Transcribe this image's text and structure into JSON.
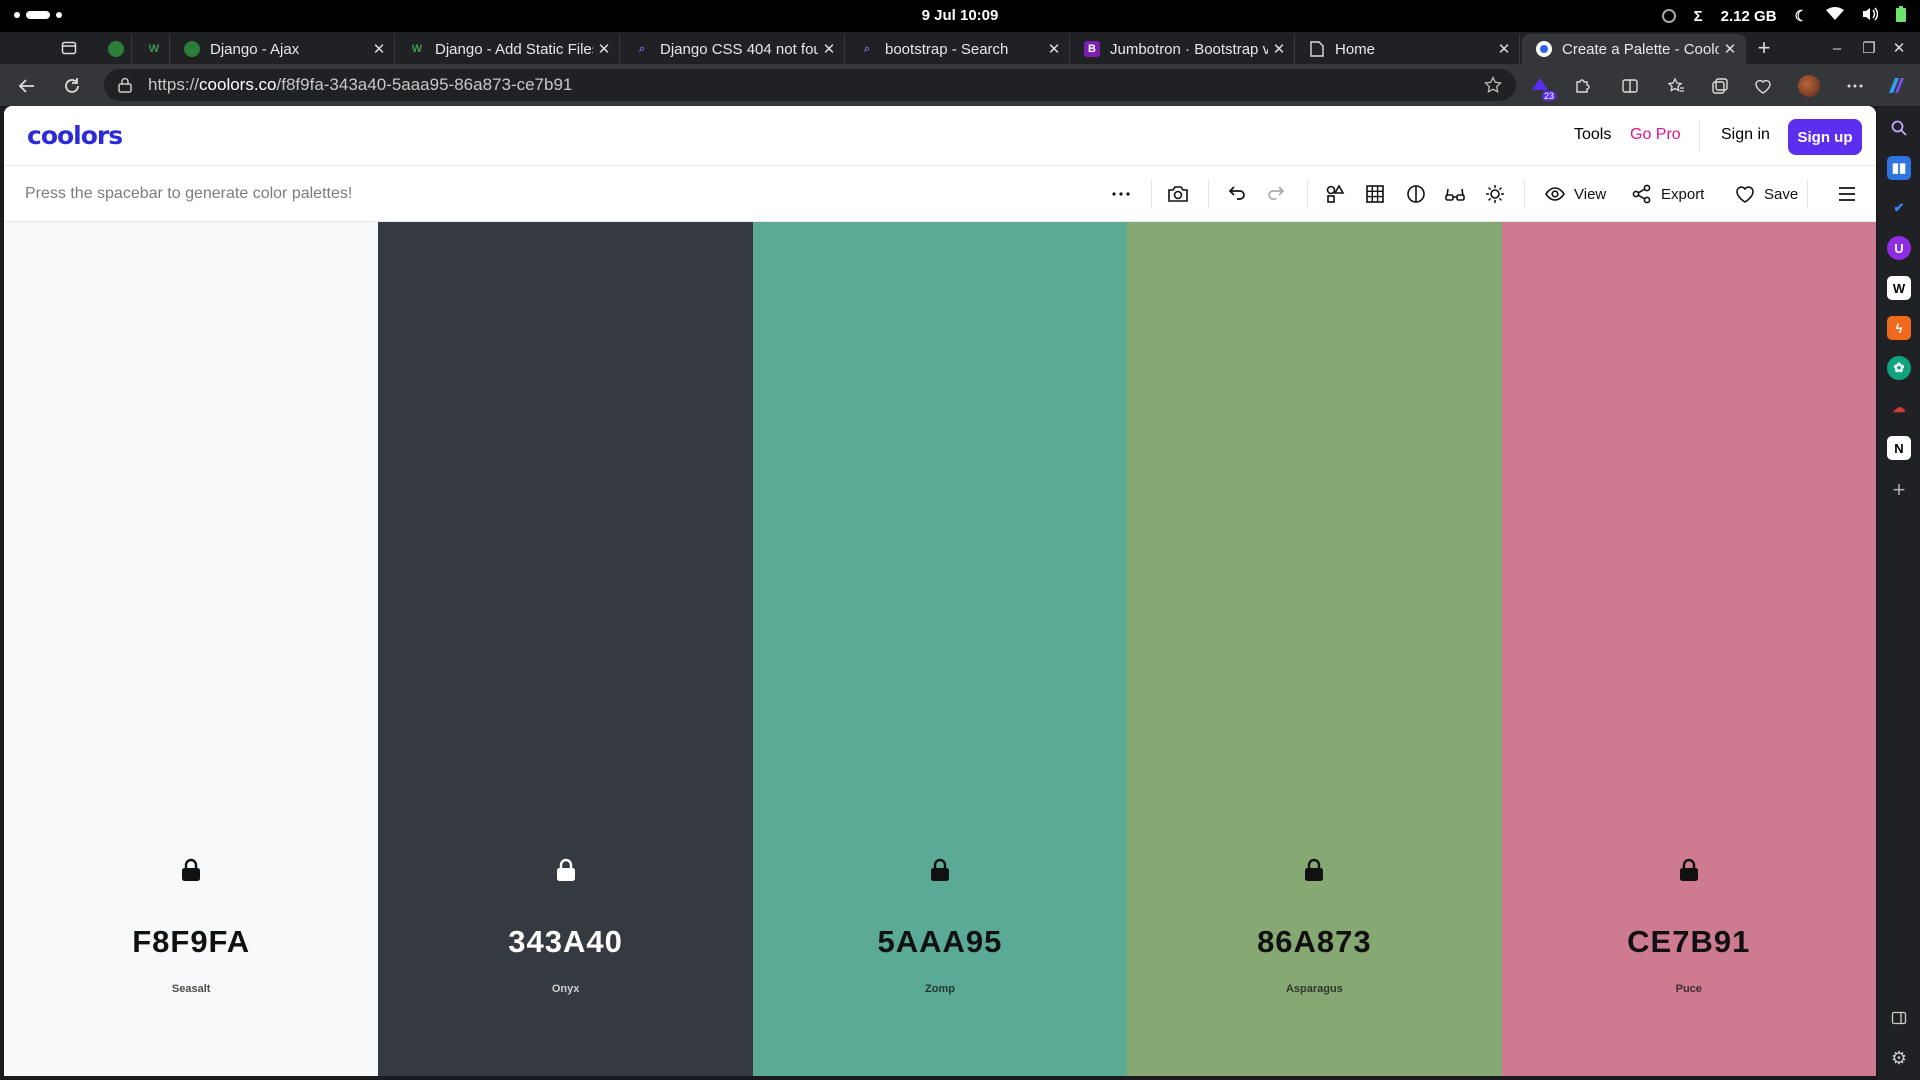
{
  "os": {
    "date_time": "9 Jul  10:09",
    "memory": "2.12 GB"
  },
  "tabs": [
    {
      "label": "",
      "icon": "github-icon"
    },
    {
      "label": "",
      "icon": "w-icon"
    },
    {
      "label": "Django - Ajax",
      "icon": "github-icon"
    },
    {
      "label": "Django - Add Static Files",
      "icon": "w-icon"
    },
    {
      "label": "Django CSS 404 not found",
      "icon": "search-icon"
    },
    {
      "label": "bootstrap - Search",
      "icon": "search-icon"
    },
    {
      "label": "Jumbotron · Bootstrap v4",
      "icon": "bootstrap-icon"
    },
    {
      "label": "Home",
      "icon": "page-icon"
    },
    {
      "label": "Create a Palette - Coolors",
      "icon": "coolors-icon"
    }
  ],
  "address": {
    "scheme": "https://",
    "domain": "coolors.co",
    "path": "/f8f9fa-343a40-5aaa95-86a873-ce7b91",
    "extension_badge": "23"
  },
  "header": {
    "logo": "coolors",
    "tools": "Tools",
    "go_pro": "Go Pro",
    "sign_in": "Sign in",
    "sign_up": "Sign up"
  },
  "toolbar": {
    "hint": "Press the spacebar to generate color palettes!",
    "view": "View",
    "export": "Export",
    "save": "Save"
  },
  "palette": [
    {
      "hex": "F8F9FA",
      "name": "Seasalt",
      "bg": "#f8f9fa",
      "fg": "#111111"
    },
    {
      "hex": "343A40",
      "name": "Onyx",
      "bg": "#343a40",
      "fg": "#ffffff"
    },
    {
      "hex": "5AAA95",
      "name": "Zomp",
      "bg": "#5aaa95",
      "fg": "#111111"
    },
    {
      "hex": "86A873",
      "name": "Asparagus",
      "bg": "#86a873",
      "fg": "#111111"
    },
    {
      "hex": "CE7B91",
      "name": "Puce",
      "bg": "#ce7b91",
      "fg": "#111111"
    }
  ]
}
